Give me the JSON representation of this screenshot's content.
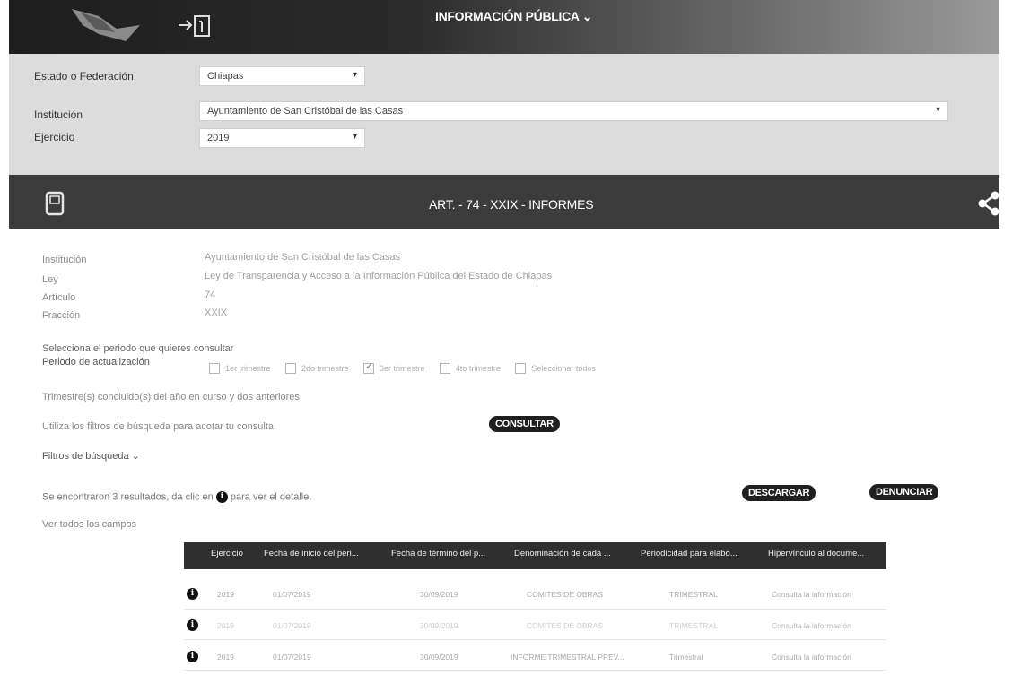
{
  "header": {
    "nav_title": "INFORMACIÓN PÚBLICA ⌄",
    "login_glyph": "⇥|",
    "logo_icon": "logo-shape"
  },
  "filters": {
    "estado_label": "Estado o Federación",
    "estado_value": "Chiapas",
    "institucion_label": "Institución",
    "institucion_value": "Ayuntamiento de San Cristóbal de las Casas",
    "ejercicio_label": "Ejercicio",
    "ejercicio_value": "2019"
  },
  "section": {
    "title": "ART. - 74 - XXIX - INFORMES",
    "doc_icon": "document-icon",
    "share_icon": "share-icon"
  },
  "info": {
    "institucion_label": "Institución",
    "institucion_value": "Ayuntamiento de San Cristóbal de las Casas",
    "ley_label": "Ley",
    "ley_value": "Ley de Transparencia y Acceso a la Información Pública del Estado de Chiapas",
    "articulo_label": "Artículo",
    "articulo_value": "74",
    "fraccion_label": "Fracción",
    "fraccion_value": "XXIX"
  },
  "period": {
    "prompt": "Selecciona el periodo que quieres consultar",
    "label": "Periodo de actualización",
    "options": [
      {
        "label": "1er trimestre",
        "checked": false
      },
      {
        "label": "2do trimestre",
        "checked": false
      },
      {
        "label": "3er trimestre",
        "checked": true
      },
      {
        "label": "4to trimestre",
        "checked": false
      },
      {
        "label": "Seleccionar todos",
        "checked": false
      }
    ],
    "note": "Trimestre(s) concluido(s) del año en curso y dos anteriores"
  },
  "search": {
    "hint": "Utiliza los filtros de búsqueda para acotar tu consulta",
    "consultar": "CONSULTAR",
    "filters_toggle": "Filtros de búsqueda ⌄"
  },
  "results": {
    "summary_pre": "Se encontraron 3 resultados, da clic en",
    "summary_post": "para ver el detalle.",
    "download": "DESCARGAR",
    "report": "DENUNCIAR",
    "all_fields": "Ver todos los campos"
  },
  "table": {
    "headers": [
      "Ejercicio",
      "Fecha de inicio del peri...",
      "Fecha de término del p...",
      "Denominación de cada ...",
      "Periodicidad para elabo...",
      "Hipervínculo al docume..."
    ],
    "rows": [
      [
        "2019",
        "01/07/2019",
        "30/09/2019",
        "COMITES DE OBRAS",
        "TRIMESTRAL",
        "Consulta la información"
      ],
      [
        "2019",
        "01/07/2019",
        "30/09/2019",
        "COMITES DE OBRAS",
        "TRIMESTRAL",
        "Consulta la información"
      ],
      [
        "2019",
        "01/07/2019",
        "30/09/2019",
        "INFORME TRIMESTRAL PREV...",
        "Trimestral",
        "Consulta la información"
      ]
    ]
  }
}
